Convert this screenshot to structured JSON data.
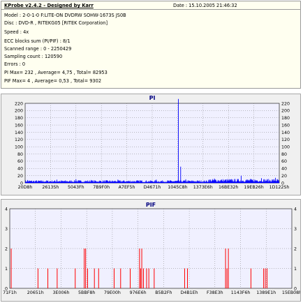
{
  "header": {
    "app_title": "KProbe v2.4.2 - Designed by Karr",
    "date_text": "Date : 15.10.2005 21:46:32"
  },
  "info": {
    "model": "Model : 2-0-1-0 F:LITE-ON DVDRW SOHW-1673S JS0B",
    "disc": "Disc : DVD-R , RITEKG05 [RITEK Corporation]",
    "speed": "Speed : 4x",
    "ecc": "ECC blocks sum (PI/PIF) : 8/1",
    "scanned": "Scanned range : 0 - 2250429",
    "sampling": "Sampling count : 120590",
    "errors": "Errors : 0",
    "pi_summary": "PI Max= 232 , Average= 4,75 , Total= 82953",
    "pif_summary": "PIF Max= 4 , Average= 0,53 , Total= 9302"
  },
  "colors": {
    "background": "#ffffff",
    "info_panel": "#fffff0",
    "chart_panel": "#f0f0f0",
    "plot_area": "#f0f0ff",
    "title": "#000080",
    "pi_series": "#0000ff",
    "pif_series": "#ff0000",
    "grid": "#7f7f7f"
  },
  "chart_data": [
    {
      "type": "bar",
      "title": "PI",
      "ylim": [
        0,
        220
      ],
      "y_ticks": [
        "0",
        "20",
        "40",
        "60",
        "80",
        "100",
        "120",
        "140",
        "160",
        "180",
        "200",
        "220"
      ],
      "x_tick_labels": [
        "20D8h",
        "2613Sh",
        "5043Fh",
        "7B9F0h",
        "A7EF5h",
        "D4671h",
        "1045C8h",
        "1373E6h",
        "16BE32h",
        "19EB26h",
        "1D122Sh"
      ],
      "grid": "dotted",
      "series": [
        {
          "baseline_level": 5,
          "spikes": [
            {
              "at": 0.01,
              "value": 8
            },
            {
              "at": 0.125,
              "value": 9
            },
            {
              "at": 0.2,
              "value": 10
            },
            {
              "at": 0.26,
              "value": 8
            },
            {
              "at": 0.365,
              "value": 9
            },
            {
              "at": 0.455,
              "value": 7
            },
            {
              "at": 0.516,
              "value": 9
            },
            {
              "at": 0.603,
              "value": 232
            },
            {
              "at": 0.612,
              "value": 45
            },
            {
              "at": 0.632,
              "value": 10
            },
            {
              "at": 0.745,
              "value": 12
            },
            {
              "at": 0.85,
              "value": 20
            },
            {
              "at": 0.93,
              "value": 13
            },
            {
              "at": 0.985,
              "value": 14
            }
          ]
        }
      ]
    },
    {
      "type": "bar",
      "title": "PIF",
      "ylim": [
        0,
        4
      ],
      "y_ticks": [
        "0",
        "1",
        "2",
        "3",
        "4"
      ],
      "x_tick_labels": [
        "71F1h",
        "20651h",
        "3E006h",
        "5BBF8h",
        "79E00h",
        "976E6h",
        "B5B2Fh",
        "D4B1Eh",
        "F38E3h",
        "1143F6h",
        "1389E1h",
        "15EB08h"
      ],
      "grid": "dotted",
      "series": [
        {
          "bars": [
            {
              "at": 0.005,
              "value": 2
            },
            {
              "at": 0.1,
              "value": 1
            },
            {
              "at": 0.135,
              "value": 1
            },
            {
              "at": 0.168,
              "value": 1
            },
            {
              "at": 0.232,
              "value": 1
            },
            {
              "at": 0.264,
              "value": 2
            },
            {
              "at": 0.269,
              "value": 2
            },
            {
              "at": 0.276,
              "value": 1
            },
            {
              "at": 0.3,
              "value": 1
            },
            {
              "at": 0.315,
              "value": 1
            },
            {
              "at": 0.37,
              "value": 1
            },
            {
              "at": 0.393,
              "value": 1
            },
            {
              "at": 0.427,
              "value": 1
            },
            {
              "at": 0.46,
              "value": 2
            },
            {
              "at": 0.464,
              "value": 1
            },
            {
              "at": 0.468,
              "value": 2
            },
            {
              "at": 0.474,
              "value": 1
            },
            {
              "at": 0.485,
              "value": 1
            },
            {
              "at": 0.493,
              "value": 1
            },
            {
              "at": 0.512,
              "value": 1
            },
            {
              "at": 0.62,
              "value": 1
            },
            {
              "at": 0.63,
              "value": 1
            },
            {
              "at": 0.765,
              "value": 2
            },
            {
              "at": 0.77,
              "value": 1
            },
            {
              "at": 0.775,
              "value": 2
            },
            {
              "at": 0.855,
              "value": 1
            },
            {
              "at": 0.9,
              "value": 1
            },
            {
              "at": 0.906,
              "value": 1
            },
            {
              "at": 0.912,
              "value": 1
            }
          ]
        }
      ]
    }
  ]
}
